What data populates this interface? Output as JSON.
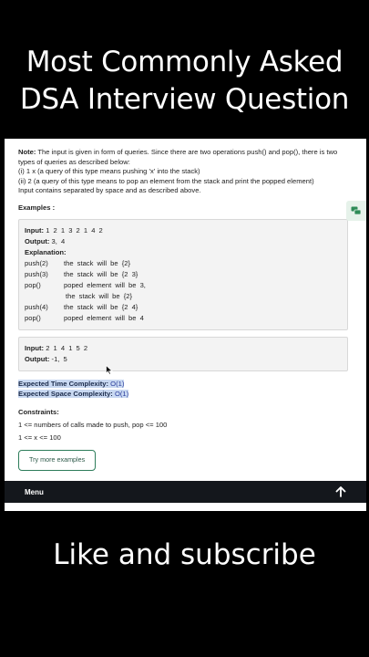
{
  "overlay": {
    "title_line1": "Most Commonly Asked",
    "title_line2": "DSA Interview Question",
    "bottom_text": "Like and subscribe"
  },
  "note": {
    "label": "Note:",
    "line1": "The input is given in form of queries. Since there are two operations push() and pop(), there is two",
    "line2": "types of queries as described below:",
    "line3": "(i) 1 x   (a query of this type means  pushing 'x' into the stack)",
    "line4": "(ii) 2     (a query of this type means to pop an element from the stack and print the popped element)",
    "line5": "Input contains separated by space and as described above."
  },
  "examples_label": "Examples :",
  "example1": {
    "input_label": "Input:",
    "input_value": "1 2 1 3 2 1 4 2",
    "output_label": "Output:",
    "output_value": "3, 4",
    "explanation_label": "Explanation:",
    "rows": [
      {
        "op": "push(2)",
        "desc": "the stack will be {2}"
      },
      {
        "op": "push(3)",
        "desc": "the stack will be {2 3}"
      },
      {
        "op": "pop()",
        "desc": "poped element will be 3,"
      },
      {
        "op": "",
        "desc": "the stack will be {2}"
      },
      {
        "op": "push(4)",
        "desc": "the stack will be {2 4}"
      },
      {
        "op": "pop()",
        "desc": "poped element will be 4"
      }
    ]
  },
  "example2": {
    "input_label": "Input:",
    "input_value": "2 1 4 1 5 2",
    "output_label": "Output:",
    "output_value": "-1, 5"
  },
  "complexity": {
    "time_label": "Expected Time Complexity:",
    "time_value": "O(1)",
    "space_label": "Expected Space Complexity:",
    "space_value": "O(1)"
  },
  "constraints": {
    "label": "Constraints:",
    "line1": "1 <= numbers of calls made to push, pop <= 100",
    "line2": "1 <= x <= 100"
  },
  "try_more_label": "Try more examples",
  "menu": {
    "label": "Menu"
  },
  "colors": {
    "background": "#000000",
    "menu_bar": "#14171c",
    "highlight": "#c9d9f2",
    "button_border": "#2e7d5b"
  }
}
